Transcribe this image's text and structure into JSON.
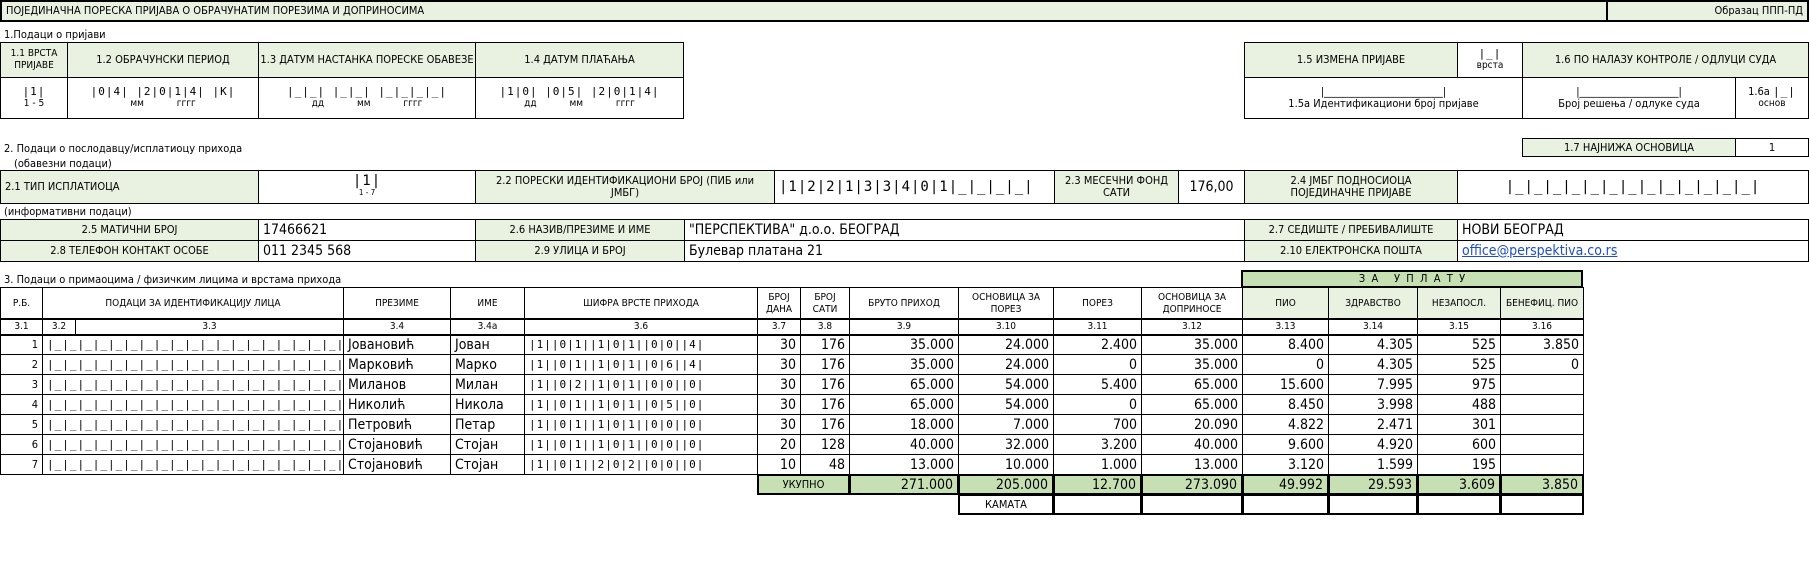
{
  "form": {
    "title": "ПОЈЕДИНАЧНА ПОРЕСКА ПРИЈАВА О ОБРАЧУНАТИМ ПОРЕЗИМА И ДОПРИНОСИМА",
    "obrazac": "Образац ППП-ПД"
  },
  "section1": {
    "heading": "1.Подаци о пријави",
    "f11_label": "1.1 ВРСТА ПРИЈАВЕ",
    "f11_value": "|1|",
    "f11_hint": "1 - 5",
    "f12_label": "1.2 ОБРАЧУНСКИ ПЕРИОД",
    "f12_value": "|0|4| |2|0|1|4|  |К|",
    "f12_hint_mm": "мм",
    "f12_hint_yyyy": "гггг",
    "f13_label": "1.3 ДАТУМ НАСТАНКА ПОРЕСКЕ ОБАВЕЗЕ",
    "f13_value": "|_|_| |_|_| |_|_|_|_|",
    "f13_hint_dd": "дд",
    "f13_hint_mm": "мм",
    "f13_hint_yyyy": "гггг",
    "f14_label": "1.4 ДАТУМ ПЛАЋАЊА",
    "f14_value": "|1|0| |0|5| |2|0|1|4|",
    "f14_hint_dd": "дд",
    "f14_hint_mm": "мм",
    "f14_hint_yyyy": "гггг",
    "f15_label": "1.5 ИЗМЕНА ПРИЈАВЕ",
    "f15_vrsta_value": "|_|",
    "f15_vrsta_label": "врста",
    "f15a_value": "|________________________|",
    "f15a_label": "1.5а Идентификациони број пријаве",
    "f16_label": "1.6 ПО НАЛАЗУ КОНТРОЛЕ / ОДЛУЦИ СУДА",
    "f16_value": "|____________________|",
    "f16_hint": "Број решења / одлуке суда",
    "f16a_label": "1.6а",
    "f16a_value": "|_|",
    "f16a_hint": "основ"
  },
  "section2": {
    "heading": "2. Подаци о послодавцу/исплатиоцу прихода",
    "mandatory": "(обавезни подаци)",
    "informative": "(информативни подаци)",
    "f17_label": "1.7 НАЈНИЖА ОСНОВИЦА",
    "f17_value": "1",
    "f21_label": "2.1 ТИП ИСПЛАТИОЦА",
    "f21_value": "|1|",
    "f21_hint": "1 - 7",
    "f22_label": "2.2 ПОРЕСКИ ИДЕНТИФИКАЦИОНИ БРОЈ (ПИБ или ЈМБГ)",
    "f22_value": "|1|2|2|1|3|3|4|0|1|_|_|_|_|",
    "f23_label": "2.3 МЕСЕЧНИ ФОНД САТИ",
    "f23_value": "176,00",
    "f24_label": "2.4 ЈМБГ ПОДНОСИОЦА ПОЈЕДИНАЧНЕ ПРИЈАВЕ",
    "f24_value": "|_|_|_|_|_|_|_|_|_|_|_|_|_|",
    "f25_label": "2.5 МАТИЧНИ БРОЈ",
    "f25_value": "17466621",
    "f26_label": "2.6 НАЗИВ/ПРЕЗИМЕ И ИМЕ",
    "f26_value": "\"ПЕРСПЕКТИВА\" д.о.о. БЕОГРАД",
    "f27_label": "2.7 СЕДИШТЕ / ПРЕБИВАЛИШТЕ",
    "f27_value": "НОВИ БЕОГРАД",
    "f28_label": "2.8 ТЕЛЕФОН КОНТАКТ ОСОБЕ",
    "f28_value": "011 2345 568",
    "f29_label": "2.9 УЛИЦА И БРОЈ",
    "f29_value": "Булевар платана 21",
    "f210_label": "2.10 ЕЛЕКТРОНСКА ПОШТА",
    "f210_value": "office@perspektiva.co.rs"
  },
  "section3": {
    "heading": "3. Подаци о примаоцима / физичким лицима и врстама прихода",
    "za_uplatu": "З  А     У  П  Л  А  Т  У",
    "headers": [
      "Р.Б.",
      "ПОДАЦИ ЗА ИДЕНТИФИКАЦИЈУ ЛИЦА",
      "ПРЕЗИМЕ",
      "ИМЕ",
      "ШИФРА ВРСТЕ ПРИХОДА",
      "БРОЈ ДАНА",
      "БРОЈ САТИ",
      "БРУТО ПРИХОД",
      "ОСНОВИЦА ЗА ПОРЕЗ",
      "ПОРЕЗ",
      "ОСНОВИЦА ЗА ДОПРИНОСЕ",
      "ПИО",
      "ЗДРАВСТВО",
      "НЕЗАПОСЛ.",
      "БЕНЕФИЦ. ПИО"
    ],
    "codes": [
      "3.1",
      "3.2",
      "3.3",
      "3.4",
      "3.4а",
      "3.6",
      "3.7",
      "3.8",
      "3.9",
      "3.10",
      "3.11",
      "3.12",
      "3.13",
      "3.14",
      "3.15",
      "3.16"
    ],
    "id_placeholder": "|_|_|_|_|_|_|_|_|_|_|_|_|_|_|_|_|_|_|_|",
    "rows": [
      {
        "rb": "1",
        "prezime": "Јовановић",
        "ime": "Јован",
        "sifra": "|1||0|1||1|0|1||0|0||4|",
        "dana": "30",
        "sati": "176",
        "bruto": "35.000",
        "osn_porez": "24.000",
        "porez": "2.400",
        "osn_dopr": "35.000",
        "pio": "8.400",
        "zdr": "4.305",
        "nez": "525",
        "ben": "3.850"
      },
      {
        "rb": "2",
        "prezime": "Марковић",
        "ime": "Марко",
        "sifra": "|1||0|1||1|0|1||0|6||4|",
        "dana": "30",
        "sati": "176",
        "bruto": "35.000",
        "osn_porez": "24.000",
        "porez": "0",
        "osn_dopr": "35.000",
        "pio": "0",
        "zdr": "4.305",
        "nez": "525",
        "ben": "0"
      },
      {
        "rb": "3",
        "prezime": "Миланов",
        "ime": "Милан",
        "sifra": "|1||0|2||1|0|1||0|0||0|",
        "dana": "30",
        "sati": "176",
        "bruto": "65.000",
        "osn_porez": "54.000",
        "porez": "5.400",
        "osn_dopr": "65.000",
        "pio": "15.600",
        "zdr": "7.995",
        "nez": "975",
        "ben": ""
      },
      {
        "rb": "4",
        "prezime": "Николић",
        "ime": "Никола",
        "sifra": "|1||0|1||1|0|1||0|5||0|",
        "dana": "30",
        "sati": "176",
        "bruto": "65.000",
        "osn_porez": "54.000",
        "porez": "0",
        "osn_dopr": "65.000",
        "pio": "8.450",
        "zdr": "3.998",
        "nez": "488",
        "ben": ""
      },
      {
        "rb": "5",
        "prezime": "Петровић",
        "ime": "Петар",
        "sifra": "|1||0|1||1|0|1||0|0||0|",
        "dana": "30",
        "sati": "176",
        "bruto": "18.000",
        "osn_porez": "7.000",
        "porez": "700",
        "osn_dopr": "20.090",
        "pio": "4.822",
        "zdr": "2.471",
        "nez": "301",
        "ben": ""
      },
      {
        "rb": "6",
        "prezime": "Стојановић",
        "ime": "Стојан",
        "sifra": "|1||0|1||1|0|1||0|0||0|",
        "dana": "20",
        "sati": "128",
        "bruto": "40.000",
        "osn_porez": "32.000",
        "porez": "3.200",
        "osn_dopr": "40.000",
        "pio": "9.600",
        "zdr": "4.920",
        "nez": "600",
        "ben": ""
      },
      {
        "rb": "7",
        "prezime": "Стојановић",
        "ime": "Стојан",
        "sifra": "|1||0|1||2|0|2||0|0||0|",
        "dana": "10",
        "sati": "48",
        "bruto": "13.000",
        "osn_porez": "10.000",
        "porez": "1.000",
        "osn_dopr": "13.000",
        "pio": "3.120",
        "zdr": "1.599",
        "nez": "195",
        "ben": ""
      }
    ],
    "ukupno_label": "УКУПНО",
    "totals": {
      "bruto": "271.000",
      "osn_porez": "205.000",
      "porez": "12.700",
      "osn_dopr": "273.090",
      "pio": "49.992",
      "zdr": "29.593",
      "nez": "3.609",
      "ben": "3.850"
    },
    "kamata_label": "КАМАТА"
  }
}
